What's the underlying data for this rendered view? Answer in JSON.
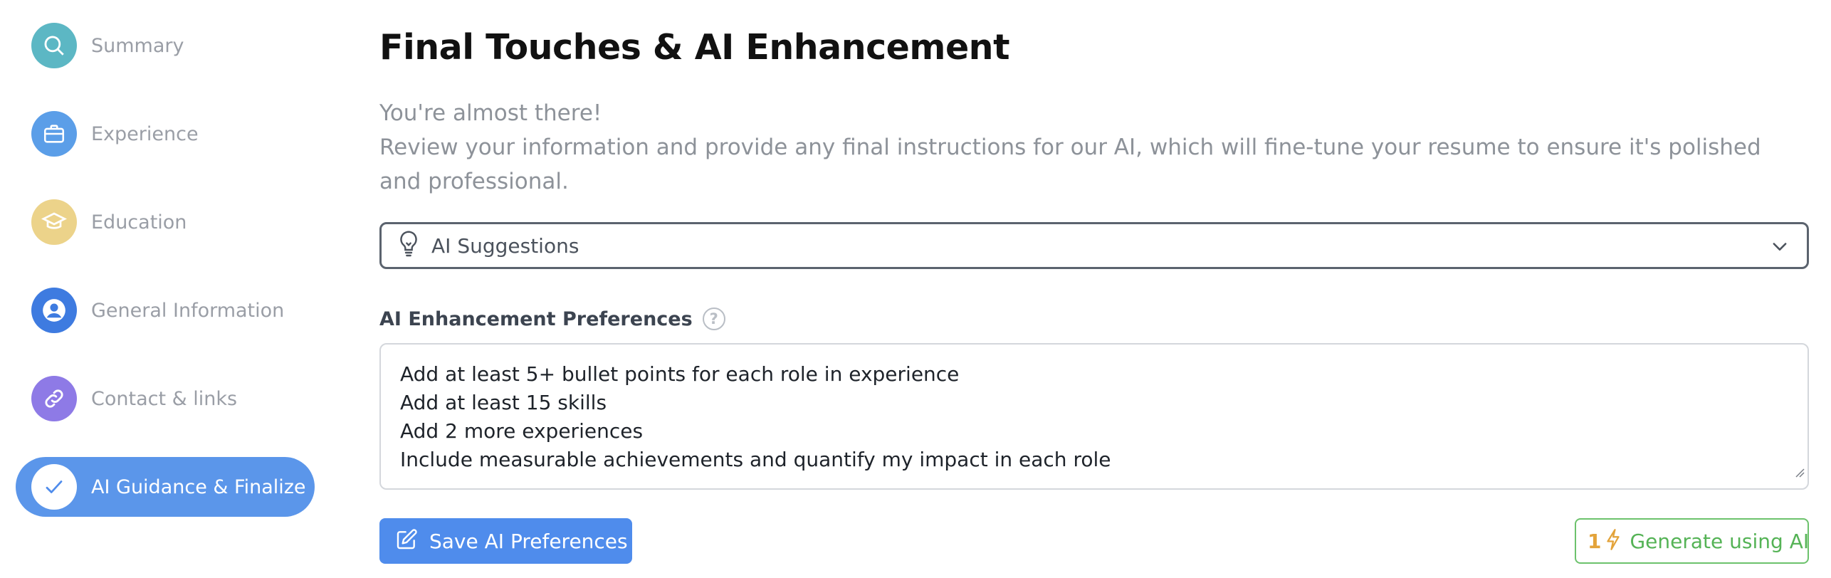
{
  "sidebar": {
    "items": [
      {
        "label": "Summary",
        "icon": "search-icon",
        "color": "#5cb7c4"
      },
      {
        "label": "Experience",
        "icon": "briefcase-icon",
        "color": "#5b9ee8"
      },
      {
        "label": "Education",
        "icon": "graduation-cap-icon",
        "color": "#ecd38a"
      },
      {
        "label": "General Information",
        "icon": "user-icon",
        "color": "#3e7be0"
      },
      {
        "label": "Contact & links",
        "icon": "link-icon",
        "color": "#8e7ae6"
      },
      {
        "label": "AI Guidance & Finalize",
        "icon": "check-icon",
        "color": "#5b96ea",
        "active": true
      }
    ]
  },
  "main": {
    "title": "Final Touches & AI Enhancement",
    "intro_line1": "You're almost there!",
    "intro_line2": "Review your information and provide any final instructions for our AI, which will fine-tune your resume to ensure it's polished and professional.",
    "suggestions_label": "AI Suggestions",
    "preferences_label": "AI Enhancement Preferences",
    "help_glyph": "?",
    "preferences_lines": [
      "Add at least 5+ bullet points for each role in experience",
      "Add at least 15 skills",
      "Add 2 more experiences",
      "Include measurable achievements and quantify my impact in each role"
    ],
    "save_label": "Save AI Preferences",
    "generate_credits": "1",
    "generate_label": "Generate using AI"
  },
  "colors": {
    "accent": "#4f8cec",
    "active_nav": "#5b96ea",
    "generate_border": "#6cc26c",
    "generate_text": "#55b356",
    "credit": "#e3a33a"
  }
}
